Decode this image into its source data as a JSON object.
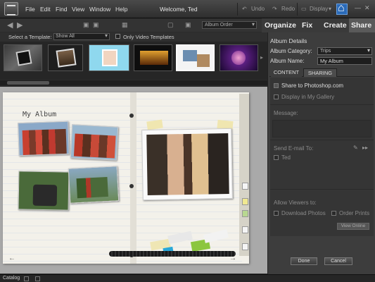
{
  "menubar": {
    "items": [
      "File",
      "Edit",
      "Find",
      "View",
      "Window",
      "Help"
    ],
    "welcome": "Welcome, Ted",
    "undo": "Undo",
    "redo": "Redo",
    "display": "Display"
  },
  "toolbar": {
    "sort_select": "Album Order"
  },
  "tabs": [
    "Organize",
    "Fix",
    "Create",
    "Share"
  ],
  "templates": {
    "select_label": "Select a Template:",
    "select_value": "Show All",
    "only_video_label": "Only Video Templates"
  },
  "book": {
    "title": "My Album"
  },
  "panel": {
    "header": "Album Details",
    "category_label": "Album Category:",
    "category_value": "Trips",
    "name_label": "Album Name:",
    "name_value": "My Album",
    "tab_content": "CONTENT",
    "tab_sharing": "SHARING",
    "share_photoshop": "Share to Photoshop.com",
    "display_gallery": "Display in My Gallery",
    "message_label": "Message:",
    "send_email_label": "Send E-mail To:",
    "recipient": "Ted",
    "allow_viewers": "Allow Viewers to:",
    "download_photos": "Download Photos",
    "order_prints": "Order Prints",
    "view_online": "View Online",
    "done": "Done",
    "cancel": "Cancel"
  },
  "status": {
    "catalog": "Catalog"
  },
  "colors": {
    "accent": "#2a6ab8",
    "panel_bg": "#3d3d3d"
  }
}
